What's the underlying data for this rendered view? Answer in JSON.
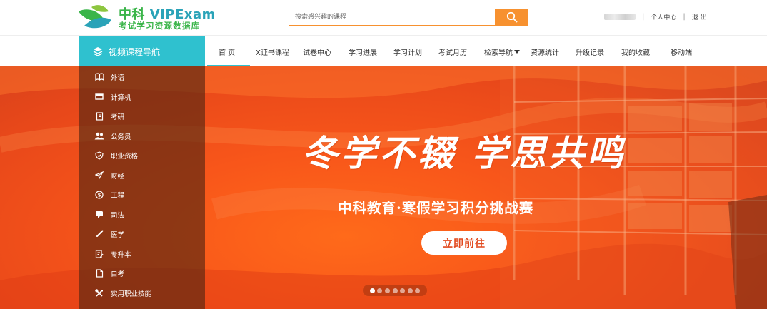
{
  "header": {
    "logo": {
      "title_cn": "中科",
      "title_en": "VIPExam",
      "subtitle": "考试学习资源数据库"
    },
    "search": {
      "placeholder": "搜索感兴趣的课程",
      "button_icon": "search-icon"
    },
    "user": {
      "username_blurred": true,
      "personal_center": "个人中心",
      "logout": "退出"
    }
  },
  "nav": {
    "category_label": "视频课程导航",
    "category_icon": "layers-icon",
    "items": [
      {
        "label": "首 页",
        "active": true
      },
      {
        "label": "X证书课程"
      },
      {
        "label": "试卷中心"
      },
      {
        "label": "学习进展"
      },
      {
        "label": "学习计划"
      },
      {
        "label": "考试月历"
      },
      {
        "label": "检索导航",
        "dropdown": true
      },
      {
        "label": "资源统计"
      },
      {
        "label": "升级记录"
      },
      {
        "label": "我的收藏"
      },
      {
        "label": "移动端"
      }
    ]
  },
  "sidebar": {
    "items": [
      {
        "label": "外语",
        "icon": "book-open-icon"
      },
      {
        "label": "计算机",
        "icon": "monitor-icon"
      },
      {
        "label": "考研",
        "icon": "notebook-icon"
      },
      {
        "label": "公务员",
        "icon": "users-icon"
      },
      {
        "label": "职业资格",
        "icon": "shield-check-icon"
      },
      {
        "label": "财经",
        "icon": "paper-plane-icon"
      },
      {
        "label": "工程",
        "icon": "dollar-circle-icon"
      },
      {
        "label": "司法",
        "icon": "comment-icon"
      },
      {
        "label": "医学",
        "icon": "pencil-icon"
      },
      {
        "label": "专升本",
        "icon": "edit-document-icon"
      },
      {
        "label": "自考",
        "icon": "document-icon"
      },
      {
        "label": "实用职业技能",
        "icon": "tools-icon"
      }
    ]
  },
  "banner": {
    "slogan": "冬学不辍 学思共鸣",
    "subtitle": "中科教育·寒假学习积分挑战赛",
    "cta": "立即前往",
    "slide_count": 7,
    "active_slide": 1
  },
  "colors": {
    "accent_teal": "#2fc1cf",
    "accent_orange": "#f7912f",
    "banner_orange": "#f8561a"
  }
}
